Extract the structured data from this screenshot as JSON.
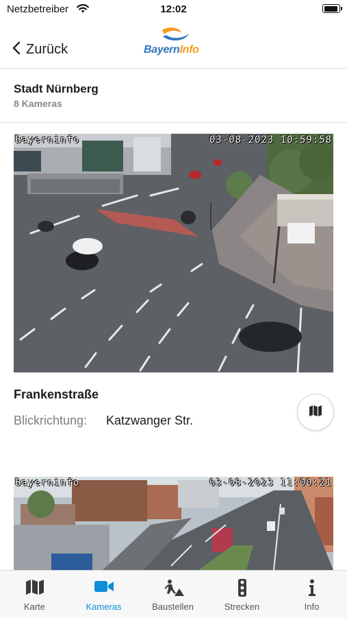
{
  "status_bar": {
    "carrier": "Netzbetreiber",
    "time": "12:02"
  },
  "nav": {
    "back_label": "Zurück",
    "logo_part1": "Bayern",
    "logo_part2": "Info"
  },
  "header": {
    "city": "Stadt Nürnberg",
    "camera_count": "8 Kameras"
  },
  "cameras": [
    {
      "overlay_brand": "Bayerninfo",
      "overlay_timestamp": "03-08-2023  10:59:58",
      "name": "Frankenstraße",
      "direction_label": "Blickrichtung:",
      "direction_value": "Katzwanger Str."
    },
    {
      "overlay_brand": "Bayerninfo",
      "overlay_timestamp": "03-08-2023  11:00:21"
    }
  ],
  "tabs": [
    {
      "label": "Karte",
      "icon": "map-icon",
      "active": false
    },
    {
      "label": "Kameras",
      "icon": "video-camera-icon",
      "active": true
    },
    {
      "label": "Baustellen",
      "icon": "construction-worker-icon",
      "active": false
    },
    {
      "label": "Strecken",
      "icon": "traffic-light-icon",
      "active": false
    },
    {
      "label": "Info",
      "icon": "info-icon",
      "active": false
    }
  ],
  "colors": {
    "accent": "#0a8fd8",
    "logo_blue": "#2f77c0",
    "logo_orange": "#f39b1c"
  }
}
